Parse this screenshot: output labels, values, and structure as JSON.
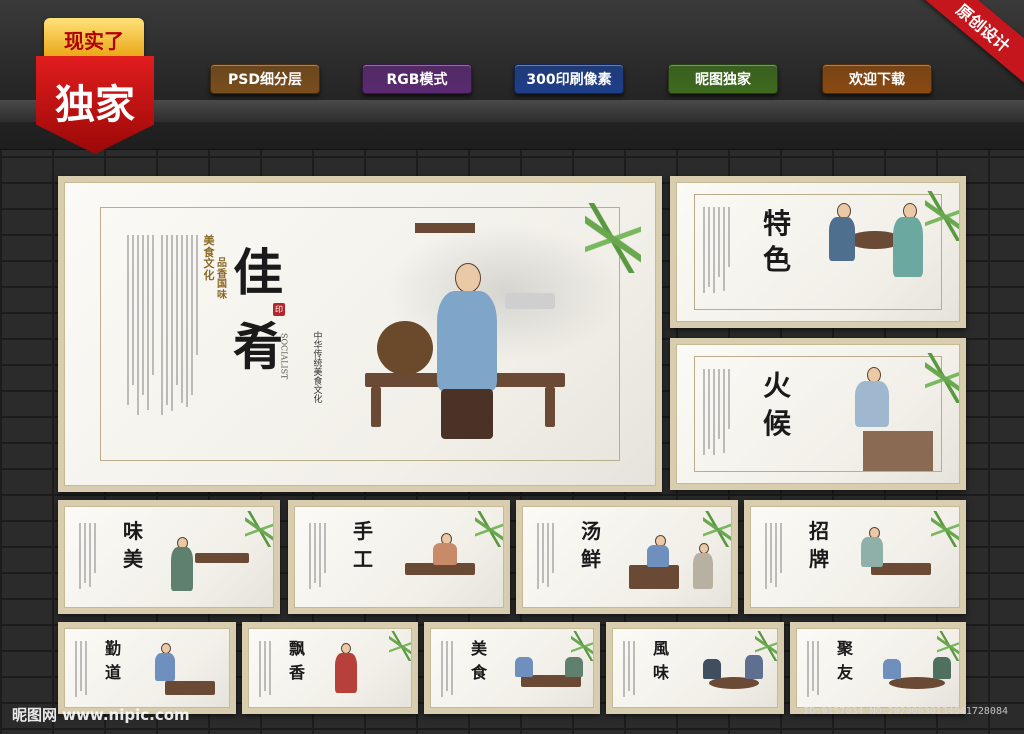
{
  "header": {
    "badge_top": "现实了",
    "badge_main": "独家",
    "corner_ribbon": "原创设计",
    "tags": [
      {
        "label": "PSD细分层",
        "color": "#7a4e1d"
      },
      {
        "label": "RGB模式",
        "color": "#5b2a72"
      },
      {
        "label": "300印刷像素",
        "color": "#1e3f8a"
      },
      {
        "label": "昵图独家",
        "color": "#3e6b1e"
      },
      {
        "label": "欢迎下载",
        "color": "#8a4a12"
      }
    ]
  },
  "panels": {
    "main": {
      "title_top": "佳",
      "title_bottom": "肴",
      "side_label": "美食文化",
      "side_label2": "品香国味",
      "english": "SOCIALIST",
      "slogan": "中华传统美食文化"
    },
    "tese": {
      "t1": "特",
      "t2": "色"
    },
    "huohou": {
      "t1": "火",
      "t2": "候"
    },
    "weimei": {
      "t1": "味",
      "t2": "美"
    },
    "shougong": {
      "t1": "手",
      "t2": "工"
    },
    "tangxian": {
      "t1": "汤",
      "t2": "鲜"
    },
    "zhaopai": {
      "t1": "招",
      "t2": "牌"
    },
    "qindao": {
      "t1": "勤",
      "t2": "道"
    },
    "piaoxiang": {
      "t1": "飘",
      "t2": "香"
    },
    "meishi": {
      "t1": "美",
      "t2": "食"
    },
    "fengwei": {
      "t1": "風",
      "t2": "味"
    },
    "juyou": {
      "t1": "聚",
      "t2": "友"
    }
  },
  "footer": {
    "site": "昵图网 www.nipic.com",
    "id_text": "ID:9157034 NO:20200830134641728084"
  }
}
